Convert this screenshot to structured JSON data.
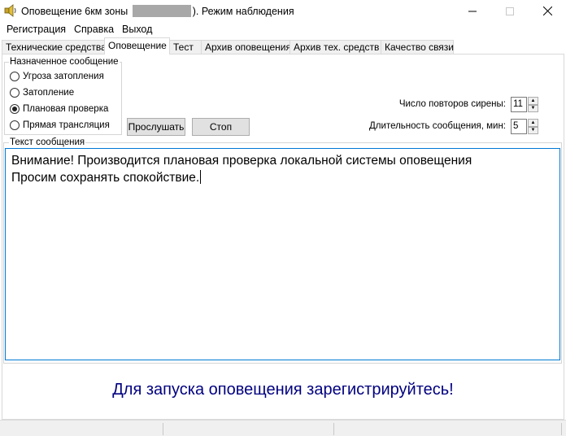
{
  "window": {
    "title_prefix": "Оповещение 6км зоны",
    "title_suffix": "). Режим наблюдения",
    "icons": {
      "app": "siren-speaker-icon",
      "minimize": "minimize-icon",
      "maximize": "maximize-icon",
      "close": "close-icon"
    }
  },
  "menu": {
    "items": [
      {
        "label": "Регистрация"
      },
      {
        "label": "Справка"
      },
      {
        "label": "Выход"
      }
    ]
  },
  "tabs": [
    {
      "label": "Технические средства",
      "active": false
    },
    {
      "label": "Оповещение",
      "active": true
    },
    {
      "label": "Тест",
      "active": false
    },
    {
      "label": "Архив оповещения",
      "active": false
    },
    {
      "label": "Архив тех. средств",
      "active": false
    },
    {
      "label": "Качество связи",
      "active": false
    }
  ],
  "assigned_message": {
    "title": "Назначенное сообщение",
    "options": [
      {
        "label": "Угроза затопления",
        "checked": false
      },
      {
        "label": "Затопление",
        "checked": false
      },
      {
        "label": "Плановая проверка",
        "checked": true
      },
      {
        "label": "Прямая трансляция",
        "checked": false
      }
    ]
  },
  "buttons": {
    "listen": "Прослушать",
    "stop": "Стоп"
  },
  "siren_repeats": {
    "label": "Число повторов сирены:",
    "value": "11"
  },
  "message_duration": {
    "label": "Длительность сообщения, мин:",
    "value": "5"
  },
  "message_text": {
    "title": "Текст сообщения",
    "line1": "Внимание! Производится плановая проверка локальной системы оповещения",
    "line2": "Просим сохранять спокойствие."
  },
  "register_note": "Для запуска оповещения зарегистрируйтесь!",
  "colors": {
    "note": "#000080",
    "focus_border": "#0078d7"
  }
}
